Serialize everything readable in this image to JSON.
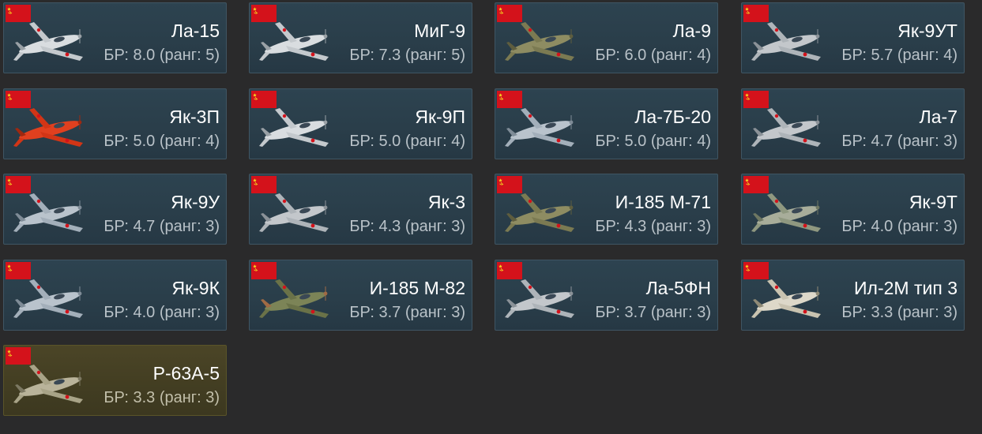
{
  "theme": {
    "background": "#2a2a2b",
    "card_bg": "#2a3e4a",
    "card_border": "#3f5563",
    "premium_bg": "#433e22",
    "flag_red": "#d4121b",
    "text": "#ffffff",
    "subtext": "#b9c2c8"
  },
  "vehicles": [
    {
      "name": "Ла-15",
      "br": "БР: 8.0 (ранг: 5)",
      "flag": "ussr-flag-icon",
      "icon": "la15-jet-icon",
      "paint": "silver",
      "premium": false
    },
    {
      "name": "МиГ-9",
      "br": "БР: 7.3 (ранг: 5)",
      "flag": "ussr-flag-icon",
      "icon": "mig9-jet-icon",
      "paint": "silver",
      "premium": false
    },
    {
      "name": "Ла-9",
      "br": "БР: 6.0 (ранг: 4)",
      "flag": "ussr-flag-icon",
      "icon": "la9-plane-icon",
      "paint": "olive",
      "premium": false
    },
    {
      "name": "Як-9УТ",
      "br": "БР: 5.7 (ранг: 4)",
      "flag": "ussr-flag-icon",
      "icon": "yak9ut-plane-icon",
      "paint": "grey",
      "premium": false
    },
    {
      "name": "Як-3П",
      "br": "БР: 5.0 (ранг: 4)",
      "flag": "ussr-flag-icon",
      "icon": "yak3p-plane-icon",
      "paint": "red",
      "premium": false
    },
    {
      "name": "Як-9П",
      "br": "БР: 5.0 (ранг: 4)",
      "flag": "ussr-flag-icon",
      "icon": "yak9p-plane-icon",
      "paint": "silver",
      "premium": false
    },
    {
      "name": "Ла-7Б-20",
      "br": "БР: 5.0 (ранг: 4)",
      "flag": "ussr-flag-icon",
      "icon": "la7b20-plane-icon",
      "paint": "blue",
      "premium": false
    },
    {
      "name": "Ла-7",
      "br": "БР: 4.7 (ранг: 3)",
      "flag": "ussr-flag-icon",
      "icon": "la7-plane-icon",
      "paint": "grey",
      "premium": false
    },
    {
      "name": "Як-9У",
      "br": "БР: 4.7 (ранг: 3)",
      "flag": "ussr-flag-icon",
      "icon": "yak9u-plane-icon",
      "paint": "blue",
      "premium": false
    },
    {
      "name": "Як-3",
      "br": "БР: 4.3 (ранг: 3)",
      "flag": "ussr-flag-icon",
      "icon": "yak3-plane-icon",
      "paint": "grey",
      "premium": false
    },
    {
      "name": "И-185 М-71",
      "br": "БР: 4.3 (ранг: 3)",
      "flag": "ussr-flag-icon",
      "icon": "i185m71-plane-icon",
      "paint": "olive",
      "premium": false
    },
    {
      "name": "Як-9Т",
      "br": "БР: 4.0 (ранг: 3)",
      "flag": "ussr-flag-icon",
      "icon": "yak9t-plane-icon",
      "paint": "camo",
      "premium": false
    },
    {
      "name": "Як-9К",
      "br": "БР: 4.0 (ранг: 3)",
      "flag": "ussr-flag-icon",
      "icon": "yak9k-plane-icon",
      "paint": "blue",
      "premium": false
    },
    {
      "name": "И-185 М-82",
      "br": "БР: 3.7 (ранг: 3)",
      "flag": "ussr-flag-icon",
      "icon": "i185m82-plane-icon",
      "paint": "green",
      "premium": false
    },
    {
      "name": "Ла-5ФН",
      "br": "БР: 3.7 (ранг: 3)",
      "flag": "ussr-flag-icon",
      "icon": "la5fn-plane-icon",
      "paint": "grey",
      "premium": false
    },
    {
      "name": "Ил-2М тип 3",
      "br": "БР: 3.3 (ранг: 3)",
      "flag": "ussr-flag-icon",
      "icon": "il2m-plane-icon",
      "paint": "winter",
      "premium": false
    },
    {
      "name": "P-63A-5",
      "br": "БР: 3.3 (ранг: 3)",
      "flag": "ussr-flag-icon",
      "icon": "p63a5-plane-icon",
      "paint": "tan",
      "premium": true
    }
  ]
}
